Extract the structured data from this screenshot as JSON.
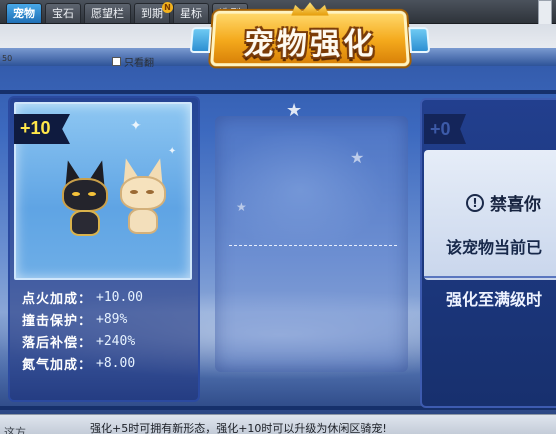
{
  "tabs": [
    {
      "label": "宠物",
      "active": true
    },
    {
      "label": "宝石",
      "active": false
    },
    {
      "label": "愿望栏",
      "active": false
    },
    {
      "label": "到期",
      "active": false,
      "badge": "N"
    },
    {
      "label": "星标",
      "active": false
    },
    {
      "label": "造型",
      "active": false
    }
  ],
  "subheader": {
    "left_number": "50",
    "only_view_label": "只看翻"
  },
  "banner": {
    "title": "宠物强化"
  },
  "pet_card": {
    "level": "+10",
    "stats": [
      {
        "label": "点火加成：",
        "value": "+10.00"
      },
      {
        "label": "撞击保护：",
        "value": "+89%"
      },
      {
        "label": "落后补偿：",
        "value": "+240%"
      },
      {
        "label": "氮气加成：",
        "value": "+8.00"
      }
    ]
  },
  "right_panel": {
    "level": "+0",
    "notice_icon": "exclamation-circle-icon",
    "notice_title": "禁喜你",
    "line1": "该宠物当前已",
    "line2": "强化至满级时"
  },
  "bottom": {
    "left_text": "这方",
    "message": "强化+5时可拥有新形态，强化+10时可以升级为休闲区骑宠!"
  },
  "colors": {
    "level_yellow": "#ffe74a",
    "tab_active": "#2a86cc",
    "banner_gold": "#f4a91c"
  }
}
